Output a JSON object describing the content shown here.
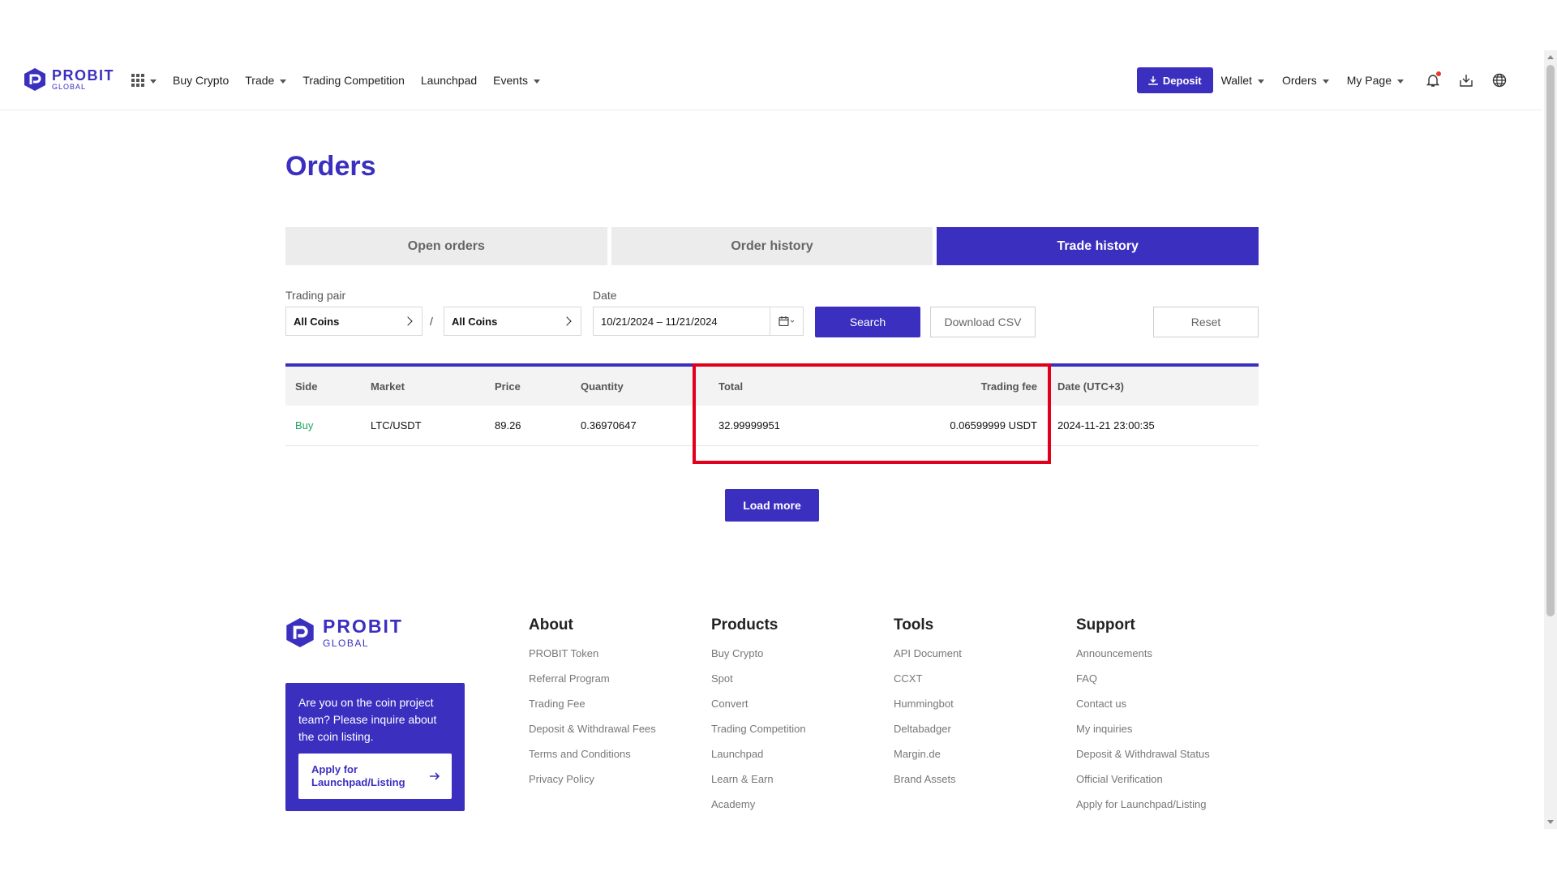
{
  "header": {
    "logo": {
      "line1": "PROBIT",
      "line2": "GLOBAL"
    },
    "nav": [
      {
        "label": "Buy Crypto",
        "caret": false
      },
      {
        "label": "Trade",
        "caret": true
      },
      {
        "label": "Trading Competition",
        "caret": false
      },
      {
        "label": "Launchpad",
        "caret": false
      },
      {
        "label": "Events",
        "caret": true
      }
    ],
    "deposit_label": "Deposit",
    "right_nav": [
      {
        "label": "Wallet"
      },
      {
        "label": "Orders"
      },
      {
        "label": "My Page"
      }
    ],
    "accent_color": "#3b2fc0"
  },
  "page": {
    "title": "Orders",
    "tabs": [
      {
        "label": "Open orders",
        "active": false
      },
      {
        "label": "Order history",
        "active": false
      },
      {
        "label": "Trade history",
        "active": true
      }
    ],
    "filters": {
      "trading_pair_label": "Trading pair",
      "base_coin": "All Coins",
      "separator": "/",
      "quote_coin": "All Coins",
      "date_label": "Date",
      "date_range": "10/21/2024 – 11/21/2024",
      "search_label": "Search",
      "csv_label": "Download CSV",
      "reset_label": "Reset"
    },
    "table": {
      "columns": [
        "Side",
        "Market",
        "Price",
        "Quantity",
        "Total",
        "Trading fee",
        "Date (UTC+3)"
      ],
      "rows": [
        {
          "side": "Buy",
          "market": "LTC/USDT",
          "price": "89.26",
          "quantity": "0.36970647",
          "total": "32.99999951",
          "fee": "0.06599999 USDT",
          "date": "2024-11-21 23:00:35"
        }
      ]
    },
    "load_more_label": "Load more",
    "highlight_color": "#e0001b"
  },
  "footer": {
    "logo": {
      "line1": "PROBIT",
      "line2": "GLOBAL"
    },
    "promo": {
      "text": "Are you on the coin project team? Please inquire about the coin listing.",
      "button": "Apply for Launchpad/Listing"
    },
    "columns": [
      {
        "title": "About",
        "links": [
          "PROBIT Token",
          "Referral Program",
          "Trading Fee",
          "Deposit & Withdrawal Fees",
          "Terms and Conditions",
          "Privacy Policy"
        ]
      },
      {
        "title": "Products",
        "links": [
          "Buy Crypto",
          "Spot",
          "Convert",
          "Trading Competition",
          "Launchpad",
          "Learn & Earn",
          "Academy"
        ]
      },
      {
        "title": "Tools",
        "links": [
          "API Document",
          "CCXT",
          "Hummingbot",
          "Deltabadger",
          "Margin.de",
          "Brand Assets"
        ]
      },
      {
        "title": "Support",
        "links": [
          "Announcements",
          "FAQ",
          "Contact us",
          "My inquiries",
          "Deposit & Withdrawal Status",
          "Official Verification",
          "Apply for Launchpad/Listing"
        ]
      }
    ]
  }
}
